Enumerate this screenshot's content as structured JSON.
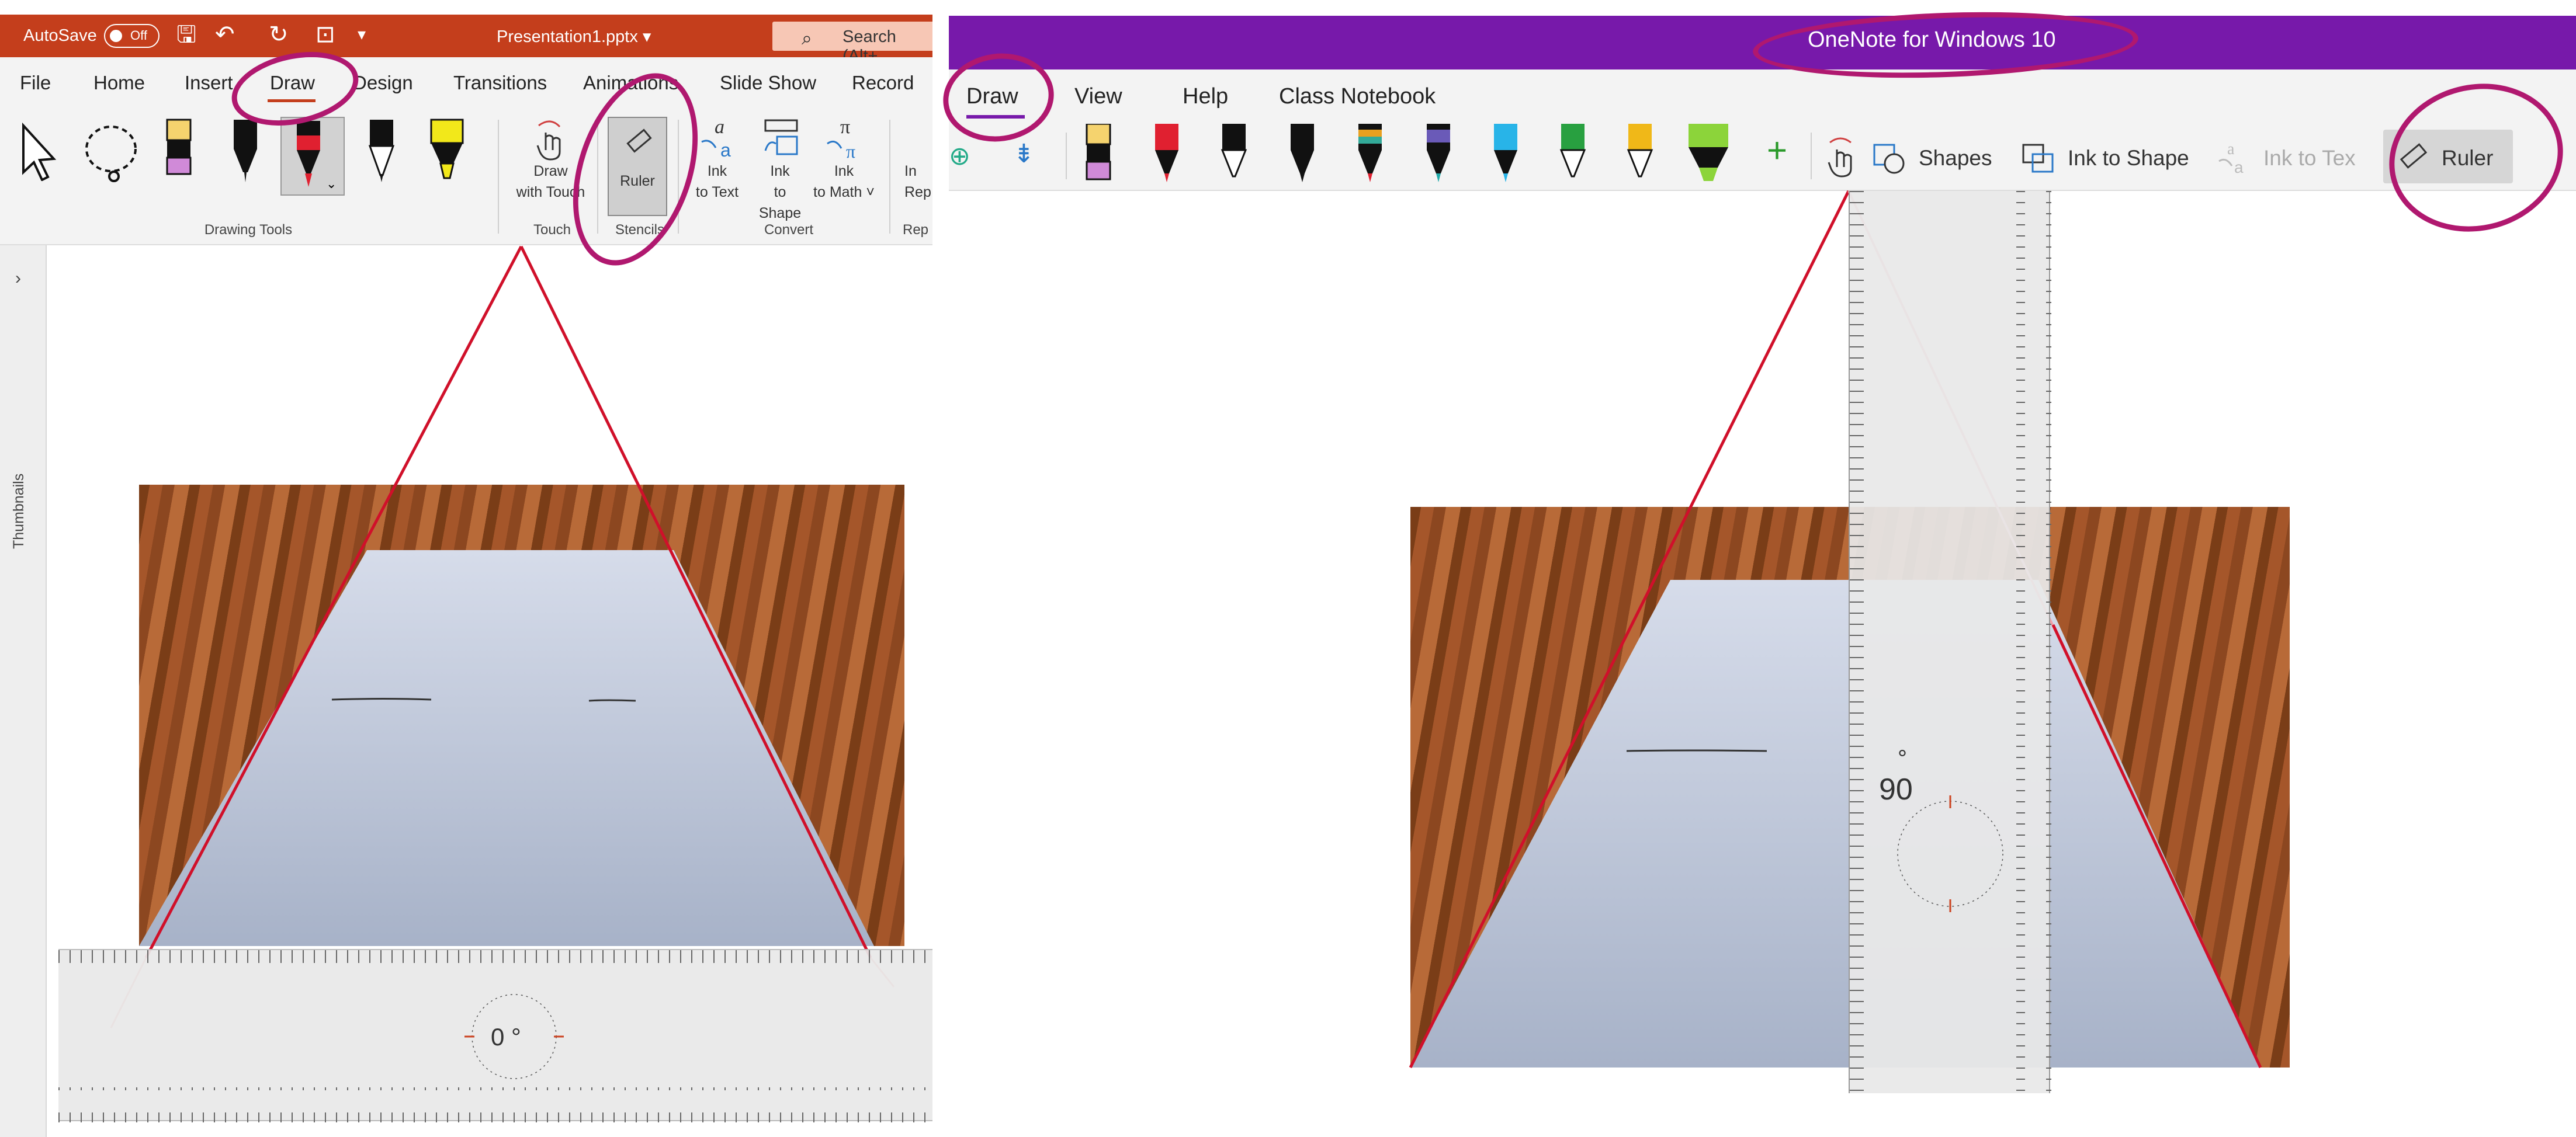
{
  "powerpoint": {
    "autosave_label": "AutoSave",
    "toggle_label": "Off",
    "file_name": "Presentation1.pptx ▾",
    "search_placeholder": "Search (Alt+",
    "tabs": [
      "File",
      "Home",
      "Insert",
      "Draw",
      "Design",
      "Transitions",
      "Animations",
      "Slide Show",
      "Record"
    ],
    "draw_with_touch": "Draw with Touch",
    "ruler_label": "Ruler",
    "ink_to_text": "Ink to Text",
    "ink_to_shape": "Ink to Shape",
    "ink_to_math": "Ink to Math ˅",
    "cut_label": "In Rep",
    "groups": {
      "drawing_tools": "Drawing Tools",
      "touch": "Touch",
      "stencils": "Stencils",
      "convert": "Convert",
      "cut": "Rep"
    },
    "thumbnails": "Thumbnails",
    "ruler_angle": "0 °"
  },
  "onenote": {
    "title": "OneNote for Windows 10",
    "tabs": [
      "Draw",
      "View",
      "Help",
      "Class Notebook"
    ],
    "shapes": "Shapes",
    "ink_to_shape": "Ink to Shape",
    "ink_to_text": "Ink to Tex",
    "ruler": "Ruler",
    "ruler_angle": "90",
    "degree": "°"
  },
  "colors": {
    "accent_ppt": "#c43e1c",
    "accent_onenote": "#7719aa",
    "annotation": "#b0186f",
    "draw_line": "#d0102a"
  },
  "icons": [
    "select-arrow-icon",
    "lasso-icon",
    "eraser-icon",
    "pen-icon",
    "pencil-icon",
    "highlighter-icon",
    "touch-hand-icon",
    "ruler-icon",
    "ink-to-text-icon",
    "ink-to-shape-icon",
    "ink-to-math-icon",
    "add-pen-icon",
    "shapes-icon",
    "undo-icon",
    "redo-icon",
    "save-icon"
  ]
}
